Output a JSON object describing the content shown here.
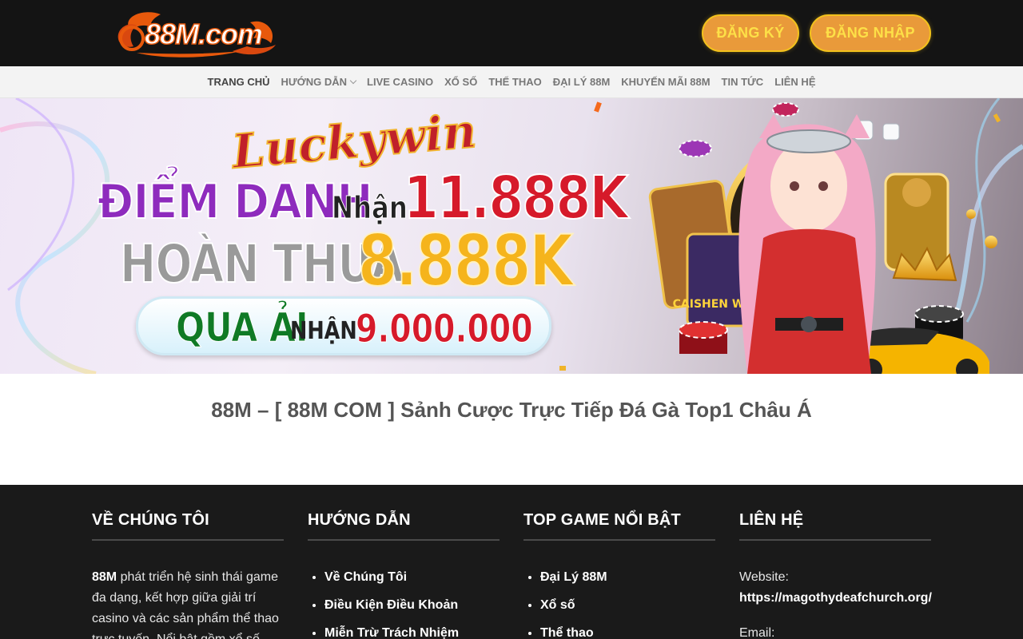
{
  "header": {
    "logo_text": "88M.com",
    "register_label": "ĐĂNG KÝ",
    "login_label": "ĐĂNG NHẬP"
  },
  "nav": {
    "items": [
      "TRANG CHỦ",
      "HƯỚNG DẪN",
      "LIVE CASINO",
      "XỔ SỐ",
      "THỂ THAO",
      "ĐẠI LÝ 88M",
      "KHUYẾN MÃI 88M",
      "TIN TỨC",
      "LIÊN HỆ"
    ]
  },
  "banner": {
    "brand": "Luckywin",
    "line1_a": "ĐIỂM DANH",
    "line1_b": "Nhận",
    "line1_amount": "11.888K",
    "line2_a": "HOÀN THUA",
    "line2_amount": "8.888K",
    "line3_a": "QUA ẢI",
    "line3_b": "NHẬN",
    "line3_amount": "9.000.000",
    "slot_label": "CAISHEN WINS"
  },
  "main": {
    "title": "88M – [ 88M COM ] Sảnh Cược Trực Tiếp Đá Gà Top1 Châu Á"
  },
  "footer": {
    "col1": {
      "title": "VỀ CHÚNG TÔI",
      "brand": "88M",
      "text": " phát triển hệ sinh thái game đa dạng, kết hợp giữa giải trí casino và các sản phẩm thể thao trực tuyến. Nổi bật gồm xổ số"
    },
    "col2": {
      "title": "HƯỚNG DẪN",
      "links": [
        "Về Chúng Tôi",
        "Điều Kiện Điều Khoản",
        "Miễn Trừ Trách Nhiệm"
      ]
    },
    "col3": {
      "title": "TOP GAME NỔI BẬT",
      "links": [
        "Đại Lý 88M",
        "Xổ số",
        "Thể thao"
      ]
    },
    "col4": {
      "title": "LIÊN HỆ",
      "website_label": "Website:",
      "website": "https://magothydeafchurch.org/",
      "email_label": "Email:"
    }
  },
  "colors": {
    "header_bg": "#141414",
    "button_bg": "#e99a3a",
    "button_text": "#fde047",
    "nav_bg": "#f3f3f3",
    "footer_bg": "#1a1a1a"
  }
}
